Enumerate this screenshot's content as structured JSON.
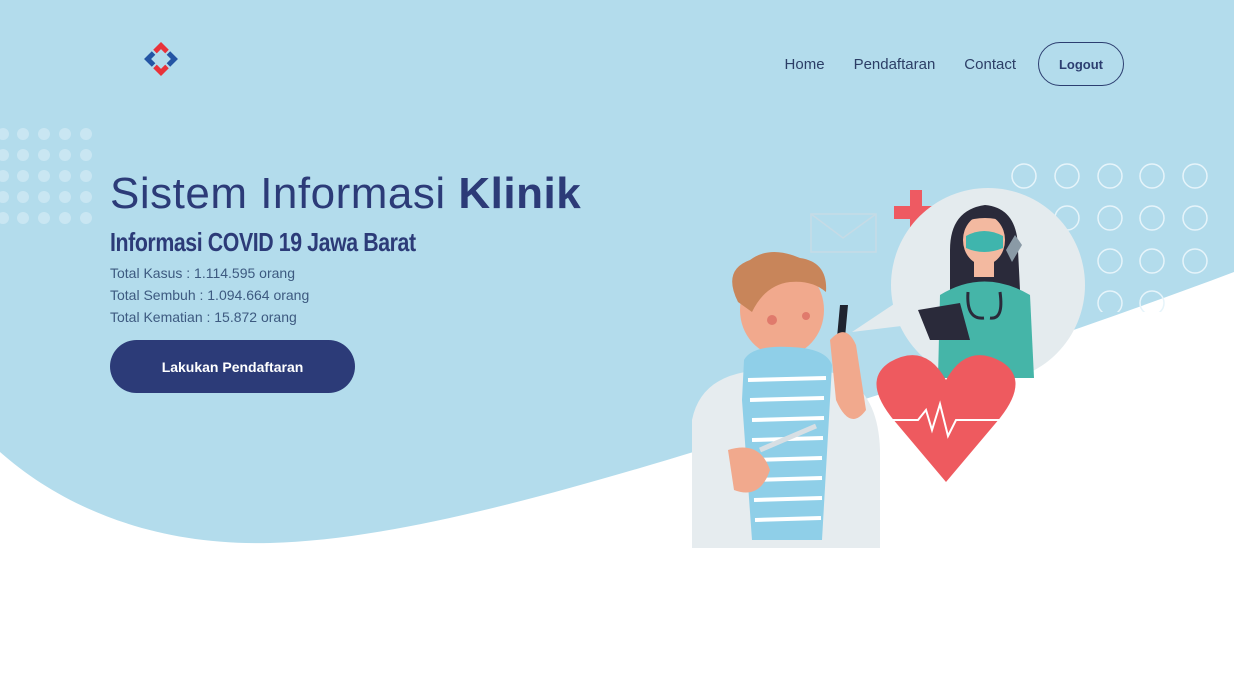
{
  "nav": {
    "items": [
      {
        "label": "Home"
      },
      {
        "label": "Pendaftaran"
      },
      {
        "label": "Contact"
      }
    ],
    "logout_label": "Logout"
  },
  "hero": {
    "title_light": "Sistem Informasi ",
    "title_bold": "Klinik",
    "subtitle": "Informasi COVID 19 Jawa Barat",
    "stats": [
      {
        "text": "Total Kasus : 1.114.595 orang"
      },
      {
        "text": "Total Sembuh : 1.094.664 orang"
      },
      {
        "text": "Total Kematian : 15.872 orang"
      }
    ],
    "cta_label": "Lakukan Pendaftaran"
  },
  "colors": {
    "hero_bg": "#b3dcec",
    "primary": "#2c3b78",
    "logo_red": "#e8323a",
    "logo_blue": "#2455a4"
  },
  "icons": {
    "logo": "clinic-logo-icon",
    "illustration": "patient-nurse-illustration"
  }
}
